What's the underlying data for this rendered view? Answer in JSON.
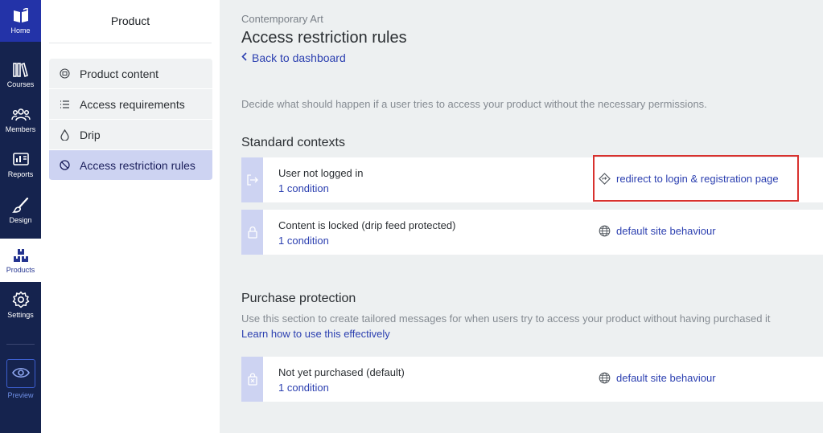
{
  "rail": {
    "items": [
      {
        "label": "Home",
        "icon": "book-icon"
      },
      {
        "label": "Courses",
        "icon": "library-icon"
      },
      {
        "label": "Members",
        "icon": "people-icon"
      },
      {
        "label": "Reports",
        "icon": "report-icon"
      },
      {
        "label": "Design",
        "icon": "brush-icon"
      },
      {
        "label": "Products",
        "icon": "boxes-icon"
      },
      {
        "label": "Settings",
        "icon": "gear-icon"
      },
      {
        "label": "Preview",
        "icon": "eye-icon"
      }
    ],
    "active": "Products"
  },
  "subnav": {
    "title": "Product",
    "items": [
      {
        "label": "Product content",
        "icon": "box-icon"
      },
      {
        "label": "Access requirements",
        "icon": "checklist-icon"
      },
      {
        "label": "Drip",
        "icon": "drop-icon"
      },
      {
        "label": "Access restriction rules",
        "icon": "block-icon"
      }
    ],
    "active": "Access restriction rules"
  },
  "main": {
    "breadcrumb": "Contemporary Art",
    "title": "Access restriction rules",
    "back_label": "Back to dashboard",
    "intro": "Decide what should happen if a user tries to access your product without the necessary permissions.",
    "standard": {
      "heading": "Standard contexts",
      "rules": [
        {
          "name": "User not logged in",
          "condition": "1 condition",
          "action": "redirect to login & registration page",
          "action_icon": "redirect-icon",
          "side_icon": "login-icon"
        },
        {
          "name": "Content is locked (drip feed protected)",
          "condition": "1 condition",
          "action": "default site behaviour",
          "action_icon": "globe-icon",
          "side_icon": "lock-icon"
        }
      ]
    },
    "purchase": {
      "heading": "Purchase protection",
      "description": "Use this section to create tailored messages for when users try to access your product without having purchased it",
      "learn_link": "Learn how to use this effectively",
      "rules": [
        {
          "name": "Not yet purchased (default)",
          "condition": "1 condition",
          "action": "default site behaviour",
          "action_icon": "globe-icon",
          "side_icon": "bag-icon"
        }
      ]
    }
  },
  "colors": {
    "rail_bg": "#15234e",
    "accent": "#2b3fb0",
    "highlight": "#d8312e",
    "active_tab": "#cdd3f2"
  }
}
